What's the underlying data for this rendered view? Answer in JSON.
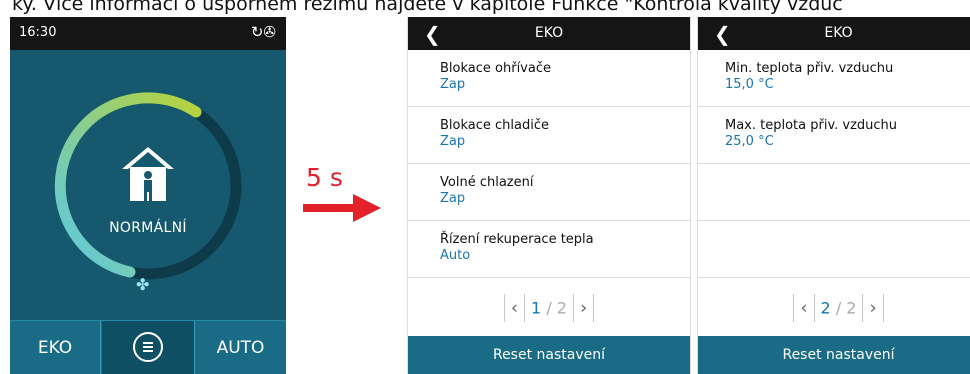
{
  "top_text": "ky. Více informací o úsporném režimu najdete v kapitole Funkce \"Kontrola kvality vzduc",
  "screen1": {
    "time": "16:30",
    "status_icons": "↻✇",
    "mode_label": "NORMÁLNÍ",
    "page_dots": {
      "count": 3,
      "active": 1
    },
    "buttons": {
      "left": "EKO",
      "right": "AUTO"
    },
    "colors": {
      "dial_start": "#5bc8e6",
      "dial_end": "#b7d33a",
      "background": "#16596e"
    }
  },
  "arrow": {
    "label": "5 s",
    "color": "#e4202a"
  },
  "screen2": {
    "title": "EKO",
    "rows": [
      {
        "label": "Blokace ohřívače",
        "value": "Zap"
      },
      {
        "label": "Blokace chladiče",
        "value": "Zap"
      },
      {
        "label": "Volné chlazení",
        "value": "Zap"
      },
      {
        "label": "Řízení rekuperace tepla",
        "value": "Auto"
      }
    ],
    "pager": {
      "current": "1",
      "total": "/ 2"
    },
    "footer": "Reset nastavení"
  },
  "screen3": {
    "title": "EKO",
    "rows": [
      {
        "label": "Min. teplota přiv. vzduchu",
        "value": "15,0 °C"
      },
      {
        "label": "Max. teplota přiv. vzduchu",
        "value": "25,0 °C"
      },
      {
        "label": "",
        "value": ""
      },
      {
        "label": "",
        "value": ""
      }
    ],
    "pager": {
      "current": "2",
      "total": "/ 2"
    },
    "footer": "Reset nastavení"
  }
}
